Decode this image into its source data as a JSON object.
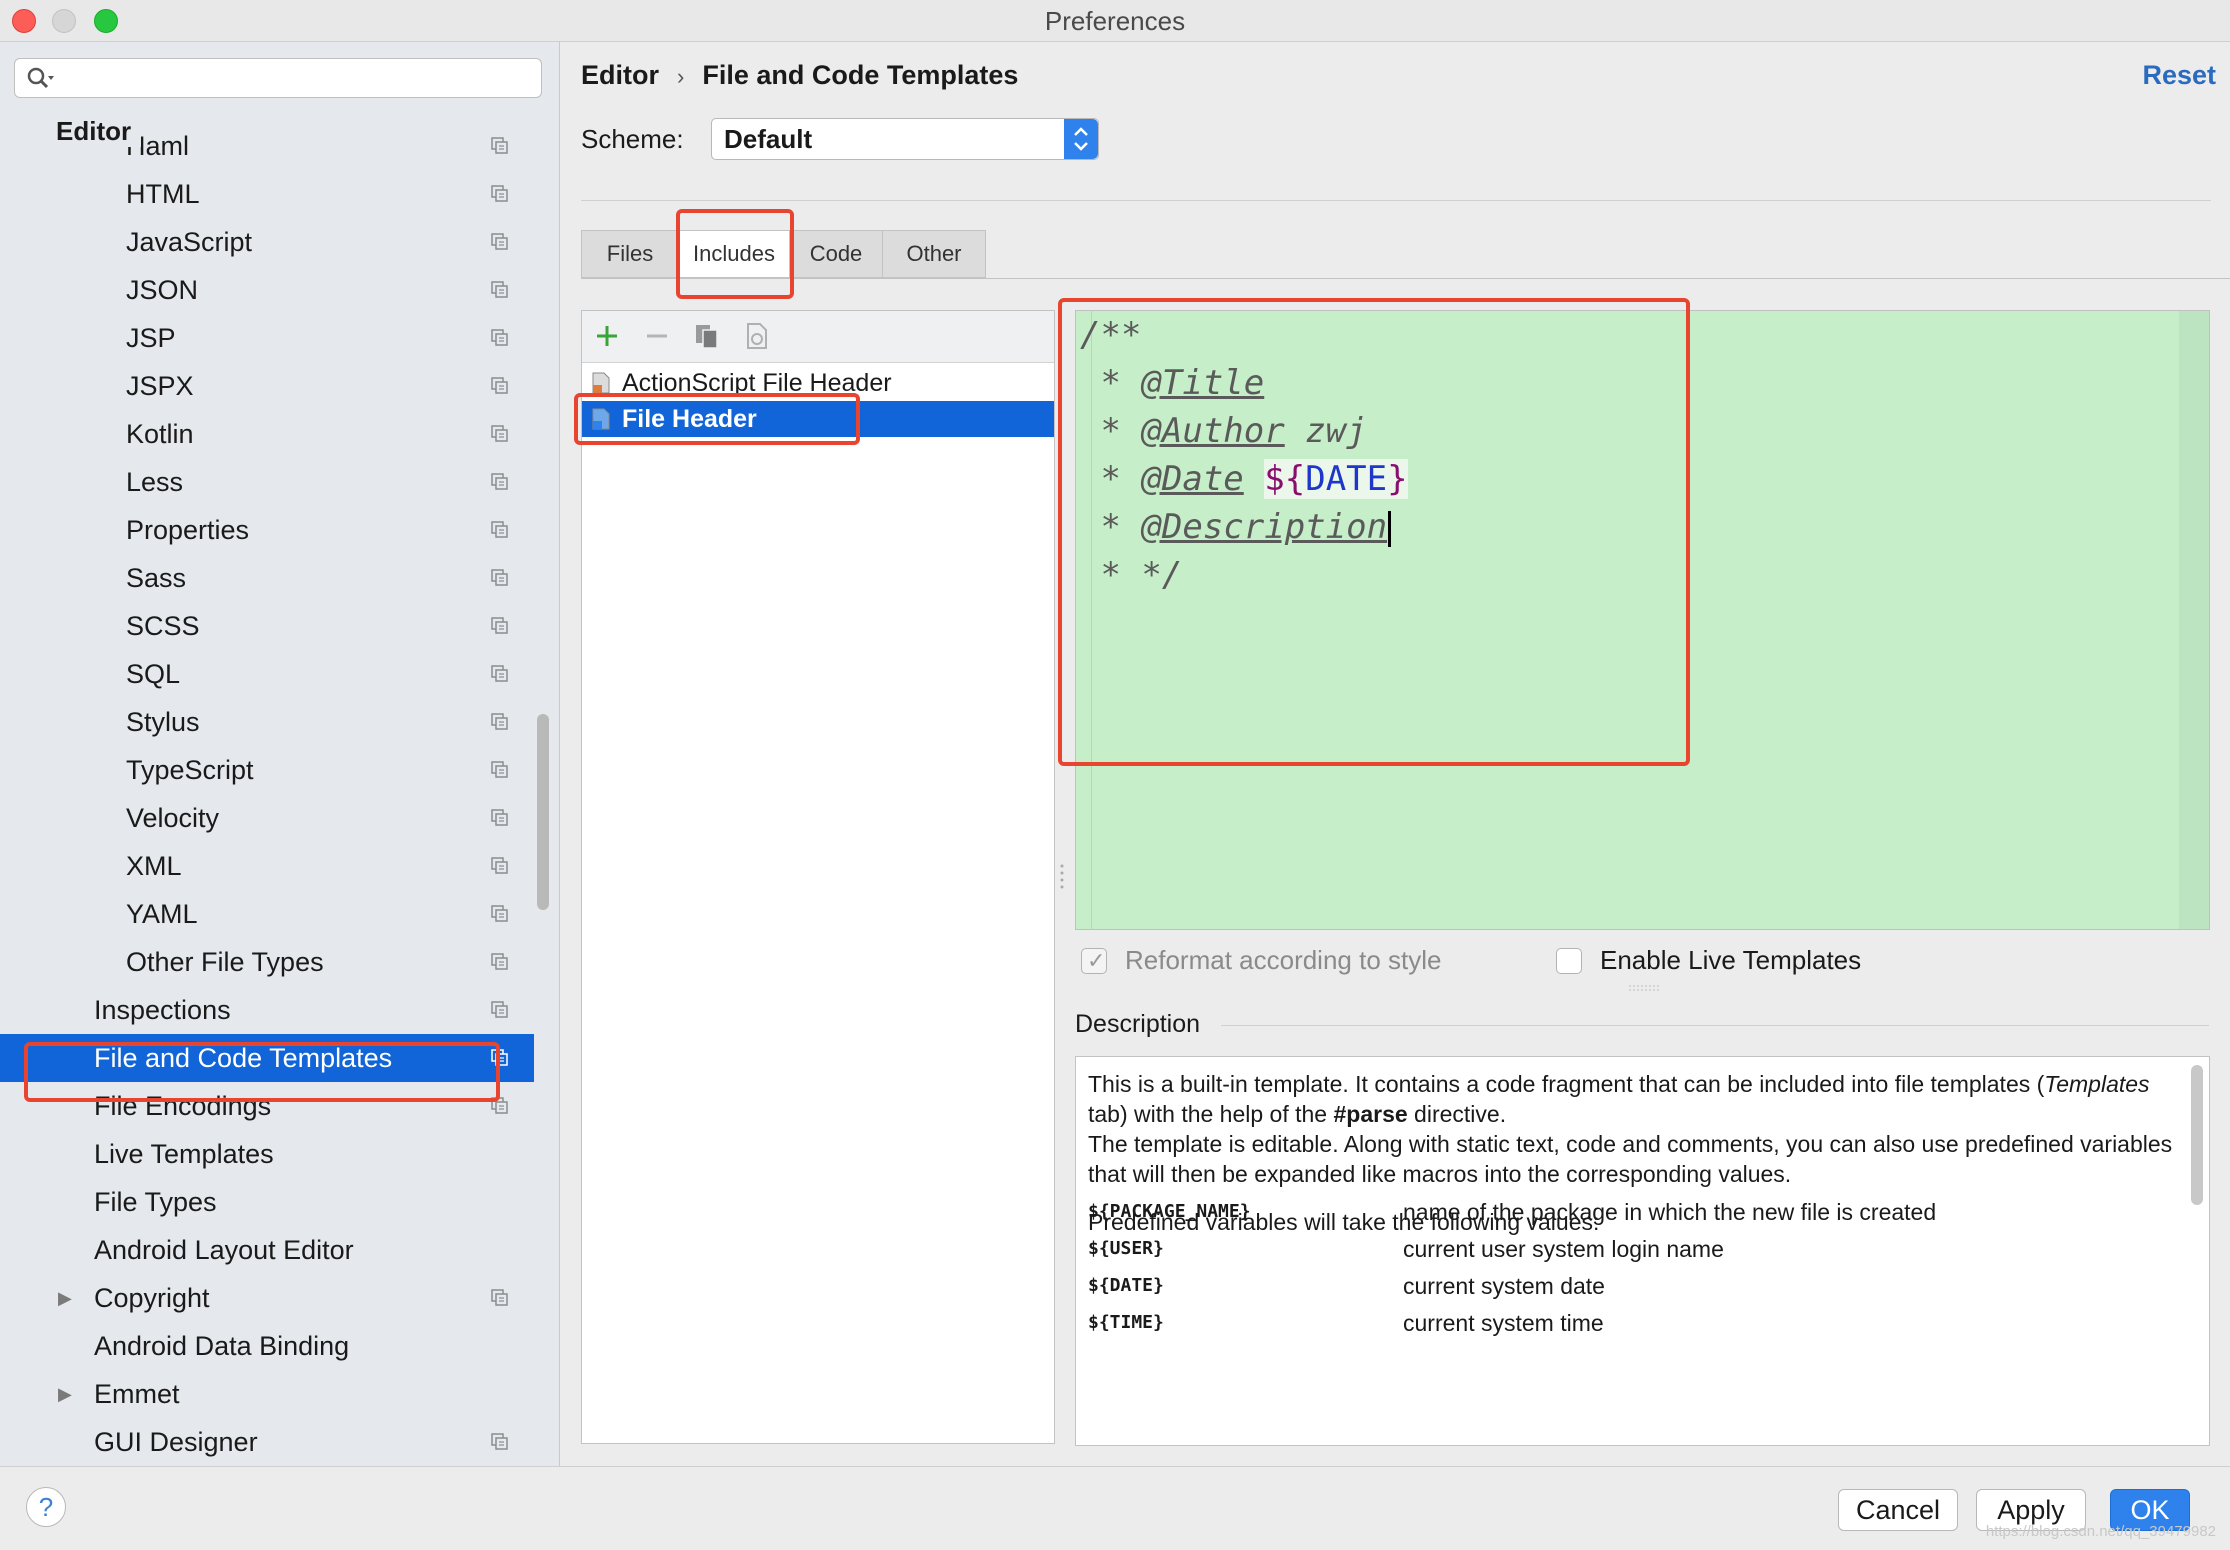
{
  "window": {
    "title": "Preferences"
  },
  "sidebar": {
    "search_placeholder": "",
    "section_header": "Editor",
    "items": [
      {
        "label": "Haml",
        "indent": 2,
        "copy": true
      },
      {
        "label": "HTML",
        "indent": 2,
        "copy": true
      },
      {
        "label": "JavaScript",
        "indent": 2,
        "copy": true
      },
      {
        "label": "JSON",
        "indent": 2,
        "copy": true
      },
      {
        "label": "JSP",
        "indent": 2,
        "copy": true
      },
      {
        "label": "JSPX",
        "indent": 2,
        "copy": true
      },
      {
        "label": "Kotlin",
        "indent": 2,
        "copy": true
      },
      {
        "label": "Less",
        "indent": 2,
        "copy": true
      },
      {
        "label": "Properties",
        "indent": 2,
        "copy": true
      },
      {
        "label": "Sass",
        "indent": 2,
        "copy": true
      },
      {
        "label": "SCSS",
        "indent": 2,
        "copy": true
      },
      {
        "label": "SQL",
        "indent": 2,
        "copy": true
      },
      {
        "label": "Stylus",
        "indent": 2,
        "copy": true
      },
      {
        "label": "TypeScript",
        "indent": 2,
        "copy": true
      },
      {
        "label": "Velocity",
        "indent": 2,
        "copy": true
      },
      {
        "label": "XML",
        "indent": 2,
        "copy": true
      },
      {
        "label": "YAML",
        "indent": 2,
        "copy": true
      },
      {
        "label": "Other File Types",
        "indent": 2,
        "copy": true
      },
      {
        "label": "Inspections",
        "indent": 1,
        "copy": true
      },
      {
        "label": "File and Code Templates",
        "indent": 1,
        "copy": true,
        "selected": true
      },
      {
        "label": "File Encodings",
        "indent": 1,
        "copy": true
      },
      {
        "label": "Live Templates",
        "indent": 1,
        "copy": false
      },
      {
        "label": "File Types",
        "indent": 1,
        "copy": false
      },
      {
        "label": "Android Layout Editor",
        "indent": 1,
        "copy": false
      },
      {
        "label": "Copyright",
        "indent": 1,
        "copy": true,
        "expandable": true
      },
      {
        "label": "Android Data Binding",
        "indent": 1,
        "copy": false
      },
      {
        "label": "Emmet",
        "indent": 1,
        "copy": false,
        "expandable": true
      },
      {
        "label": "GUI Designer",
        "indent": 1,
        "copy": true
      }
    ]
  },
  "main": {
    "breadcrumb": {
      "parent": "Editor",
      "separator": "›",
      "current": "File and Code Templates"
    },
    "reset_label": "Reset",
    "scheme": {
      "label": "Scheme:",
      "value": "Default"
    },
    "tabs": [
      {
        "label": "Files"
      },
      {
        "label": "Includes",
        "active": true
      },
      {
        "label": "Code"
      },
      {
        "label": "Other"
      }
    ],
    "template_list": [
      {
        "label": "ActionScript File Header"
      },
      {
        "label": "File Header",
        "selected": true
      }
    ],
    "editor": {
      "line1": "/**",
      "line2_prefix": " * ",
      "line2_tag": "@Title",
      "line3_prefix": " * ",
      "line3_tag": "@Author",
      "line3_rest": " zwj",
      "line4_prefix": " * ",
      "line4_tag": "@Date",
      "line4_dollar": "$",
      "line4_var_open": "{",
      "line4_var": "DATE",
      "line4_var_close": "}",
      "line5_prefix": " * ",
      "line5_tag": "@Description",
      "line6": " * */"
    },
    "options": {
      "reformat_label": "Reformat according to style",
      "reformat_checked": true,
      "live_templates_label": "Enable Live Templates",
      "live_templates_checked": false
    },
    "description": {
      "title": "Description",
      "p1_a": "This is a built-in template. It contains a code fragment that can be included into file templates (",
      "p1_italic": "Templates",
      "p1_b": " tab) with the help of the ",
      "p1_bold": "#parse",
      "p1_c": " directive.",
      "p1_d": "The template is editable. Along with static text, code and comments, you can also use predefined variables that will then be expanded like macros into the corresponding values.",
      "p2": "Predefined variables will take the following values:",
      "vars": [
        {
          "name": "${PACKAGE_NAME}",
          "desc": "name of the package in which the new file is created"
        },
        {
          "name": "${USER}",
          "desc": "current user system login name"
        },
        {
          "name": "${DATE}",
          "desc": "current system date"
        },
        {
          "name": "${TIME}",
          "desc": "current system time"
        }
      ]
    }
  },
  "footer": {
    "help_label": "?",
    "cancel_label": "Cancel",
    "apply_label": "Apply",
    "ok_label": "OK",
    "watermark": "https://blog.csdn.net/qq_39479982"
  },
  "colors": {
    "selection": "#1165d8",
    "editor_bg": "#c6eec9",
    "accent": "#2f82ec",
    "highlight": "#e7452f"
  }
}
